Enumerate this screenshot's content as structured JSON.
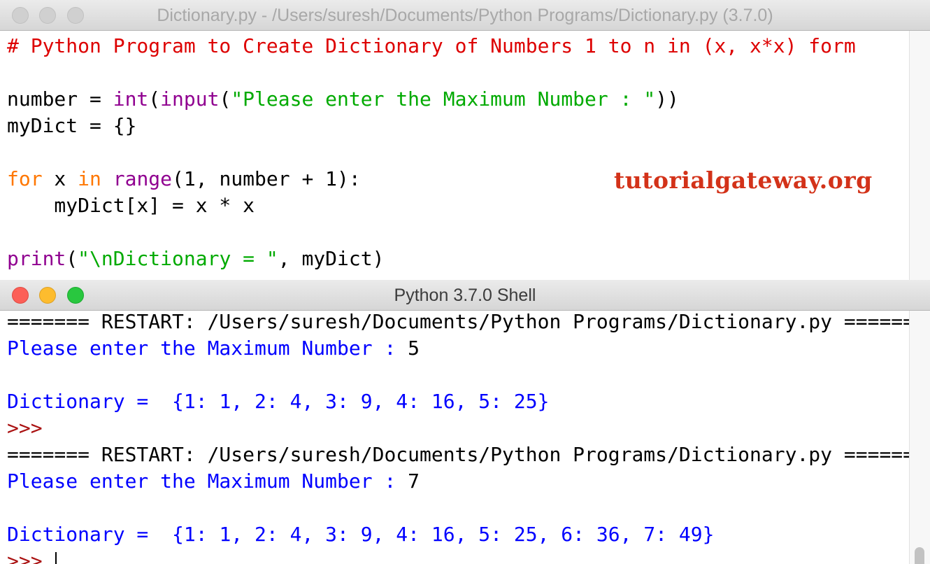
{
  "editor": {
    "title": "Dictionary.py - /Users/suresh/Documents/Python Programs/Dictionary.py (3.7.0)",
    "watermark": "tutorialgateway.org",
    "code": {
      "l1": "# Python Program to Create Dictionary of Numbers 1 to n in (x, x*x) form",
      "l3": {
        "a": "number = ",
        "int": "int",
        "p1": "(",
        "input": "input",
        "p2": "(",
        "s": "\"Please enter the Maximum Number : \"",
        "p3": "))"
      },
      "l4": "myDict = {}",
      "l6": {
        "for": "for",
        "a": " x ",
        "in": "in",
        "b": " ",
        "range": "range",
        "c": "(1, number + 1):"
      },
      "l7": "    myDict[x] = x * x",
      "l9": {
        "print": "print",
        "a": "(",
        "s": "\"\\nDictionary = \"",
        "b": ", myDict)"
      }
    }
  },
  "shell": {
    "title": "Python 3.7.0 Shell",
    "restart": "======= RESTART: /Users/suresh/Documents/Python Programs/Dictionary.py =======",
    "prompt_text": "Please enter the Maximum Number : ",
    "dict_label": "Dictionary =  ",
    "run1": {
      "input": "5",
      "result": "{1: 1, 2: 4, 3: 9, 4: 16, 5: 25}"
    },
    "run2": {
      "input": "7",
      "result": "{1: 1, 2: 4, 3: 9, 4: 16, 5: 25, 6: 36, 7: 49}"
    },
    "prompt": ">>>",
    "prompt_last": ">>> "
  }
}
